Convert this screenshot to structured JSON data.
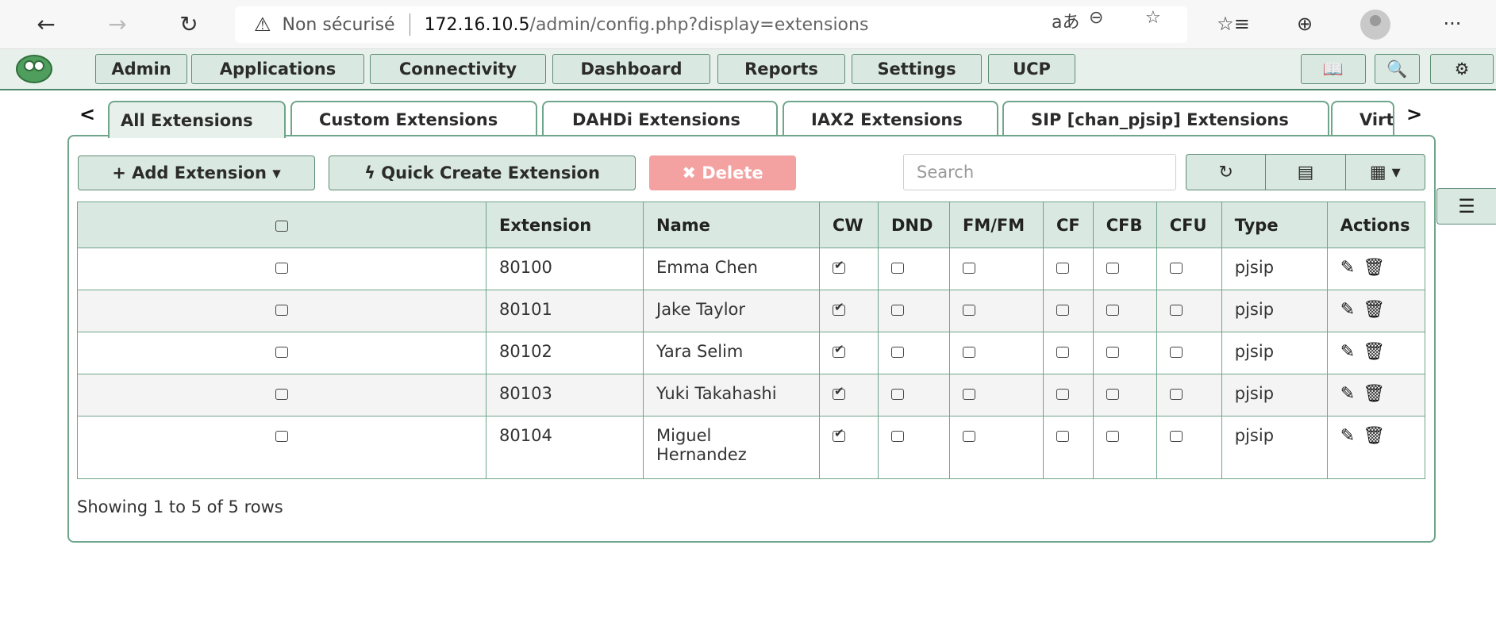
{
  "browser": {
    "back_icon": "←",
    "forward_icon": "→",
    "reload_icon": "↻",
    "insecure_label": "Non sécurisé",
    "url_host": "172.16.10.5",
    "url_path": "/admin/config.php?display=extensions",
    "read_aloud_icon": "aあ",
    "zoom_icon": "⊖",
    "fav_add_icon": "☆",
    "favorites_icon": "☆≡",
    "collections_icon": "⊕",
    "more_icon": "···"
  },
  "menu": {
    "items": [
      "Admin",
      "Applications",
      "Connectivity",
      "Dashboard",
      "Reports",
      "Settings",
      "UCP"
    ],
    "lang_icon": "📖",
    "search_icon": "🔍",
    "gear_icon": "⚙"
  },
  "tabs": [
    "All Extensions",
    "Custom Extensions",
    "DAHDi Extensions",
    "IAX2 Extensions",
    "SIP [chan_pjsip] Extensions",
    "Virt"
  ],
  "toolbar": {
    "add_label": "+ Add Extension ▾",
    "quick_create_label": "ϟ Quick Create Extension",
    "delete_label": "✖ Delete",
    "search_placeholder": "Search",
    "refresh_icon": "↻",
    "toggle_icon": "▤",
    "columns_icon": "▦ ▾"
  },
  "table": {
    "headers": [
      "Extension",
      "Name",
      "CW",
      "DND",
      "FM/FM",
      "CF",
      "CFB",
      "CFU",
      "Type",
      "Actions"
    ],
    "rows": [
      {
        "ext": "80100",
        "name": "Emma Chen",
        "type": "pjsip"
      },
      {
        "ext": "80101",
        "name": "Jake Taylor",
        "type": "pjsip"
      },
      {
        "ext": "80102",
        "name": "Yara Selim",
        "type": "pjsip"
      },
      {
        "ext": "80103",
        "name": "Yuki Takahashi",
        "type": "pjsip"
      },
      {
        "ext": "80104",
        "name": "Miguel Hernandez",
        "type": "pjsip"
      }
    ],
    "actions_icons": "✎🗑"
  },
  "footer": {
    "showing": "Showing 1 to 5 of 5 rows"
  }
}
